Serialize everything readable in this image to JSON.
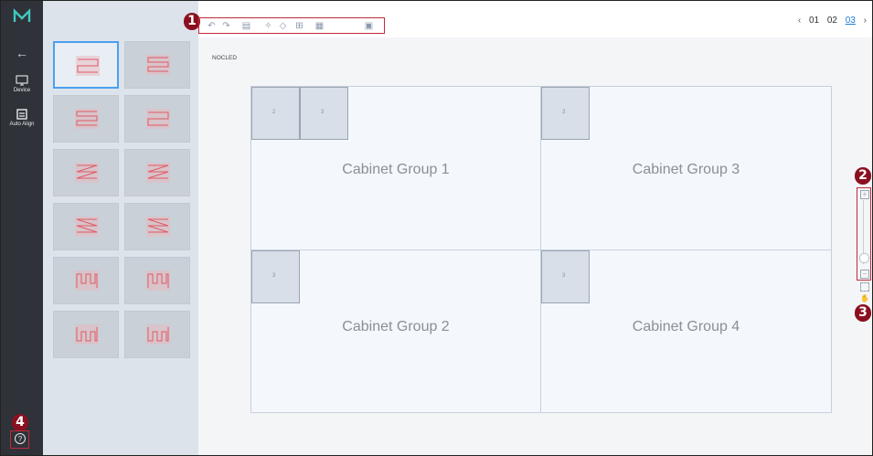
{
  "nav": {
    "items": [
      {
        "label": "Device",
        "icon": "monitor-icon"
      },
      {
        "label": "Auto Align",
        "icon": "auto-align-icon"
      }
    ],
    "back_icon": "back-arrow-icon",
    "help_icon": "help-icon"
  },
  "callouts": [
    "1",
    "2",
    "3",
    "4"
  ],
  "pager": {
    "pages": [
      "01",
      "02",
      "03"
    ],
    "current": "03"
  },
  "canvas": {
    "label": "NOCLED",
    "groups": [
      {
        "name": "Cabinet Group 1",
        "cabinets": [
          "2",
          "3"
        ]
      },
      {
        "name": "Cabinet Group 3",
        "cabinets": [
          "3"
        ]
      },
      {
        "name": "Cabinet Group 2",
        "cabinets": [
          "3"
        ]
      },
      {
        "name": "Cabinet Group 4",
        "cabinets": [
          "3"
        ]
      }
    ]
  },
  "colors": {
    "nav_bg": "#2f3238",
    "accent": "#4aa0f0",
    "callout": "#8a1020",
    "highlight_box": "#c02a3a"
  }
}
